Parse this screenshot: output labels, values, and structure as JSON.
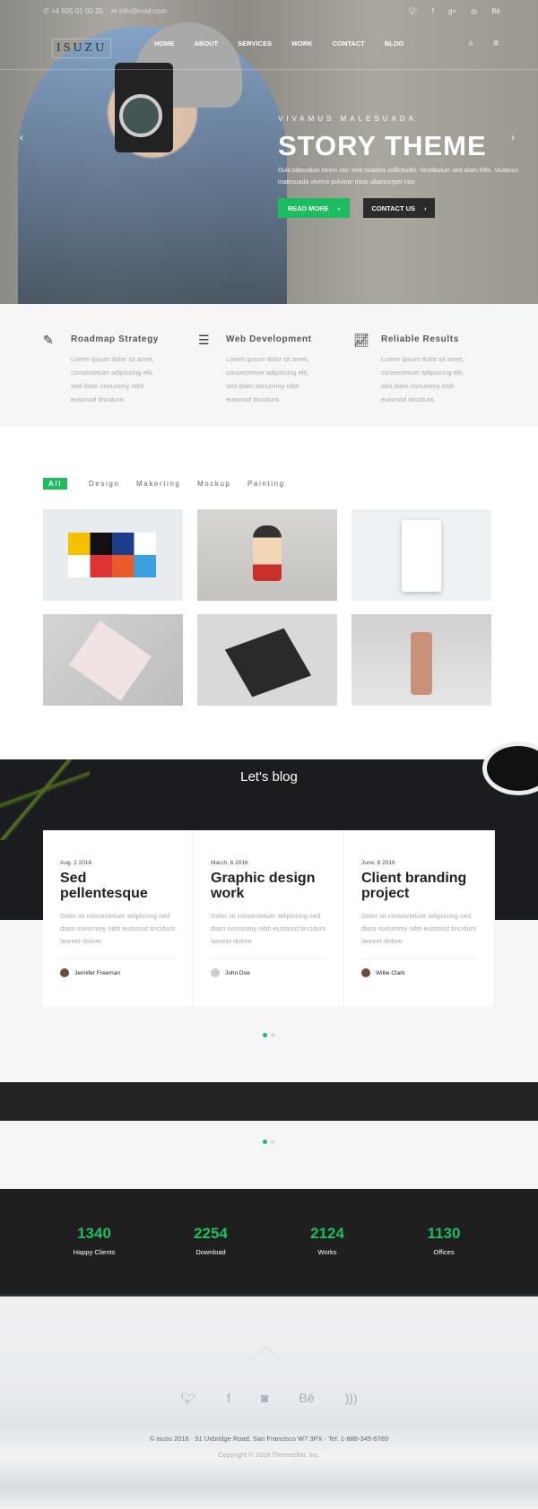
{
  "topbar": {
    "phone": "+4 905 01 00 25",
    "email": "info@mail.com",
    "social": [
      "twitter",
      "facebook",
      "google-plus",
      "instagram",
      "Bē"
    ]
  },
  "nav": {
    "logo": "ISUZU",
    "items": [
      "HOME",
      "ABOUT",
      "SERVICES",
      "WORK",
      "CONTACT",
      "BLOG"
    ]
  },
  "hero": {
    "subtitle": "VIVAMUS MALESUADA",
    "title": "STORY THEME",
    "body": "Duis bibendum lorem non velit sodales sollicitudin. Vestibulum sed diam felis. Vivamus malesuada viverra pulvinar risus ullamcorper non",
    "read_more": "READ MORE",
    "contact": "CONTACT US"
  },
  "features": [
    {
      "icon": "pen-tool-icon",
      "title": "Roadmap Strategy",
      "text": "Lorem ipsum dolor sit amet, consectetuer adipiscing elit, sed diam nonummy nibh euismod tincidunt."
    },
    {
      "icon": "sliders-icon",
      "title": "Web Development",
      "text": "Lorem ipsum dolor sit amet, consectetuer adipiscing elit, sed diam nonummy nibh euismod tincidunt."
    },
    {
      "icon": "chart-icon",
      "title": "Reliable Results",
      "text": "Lorem ipsum dolor sit amet, consectetuer adipiscing elit, sed diam nonummy nibh euismod tincidunt."
    }
  ],
  "filters": [
    "All",
    "Design",
    "Makerting",
    "Mockup",
    "Painting"
  ],
  "blog": {
    "heading": "Let's blog",
    "posts": [
      {
        "date": "Aug. 2 2016",
        "title": "Sed pellentesque",
        "text": "Dolor sit consectetuer adipiscing sed diam nonummy nibh euismod tincidunt laoreet dolore",
        "author": "Jennifer Freeman"
      },
      {
        "date": "March. 6 2016",
        "title": "Graphic design work",
        "text": "Dolor sit consectetuer adipiscing sed diam nonummy nibh euismod tincidunt laoreet dolore",
        "author": "John Doe"
      },
      {
        "date": "June. 8 2016",
        "title": "Client branding project",
        "text": "Dolor sit consectetuer adipiscing sed diam nonummy nibh euismod tincidunt laoreet dolore",
        "author": "Willie Clark"
      }
    ]
  },
  "stats": [
    {
      "n": "1340",
      "l": "Happy Clients"
    },
    {
      "n": "2254",
      "l": "Download"
    },
    {
      "n": "2124",
      "l": "Works"
    },
    {
      "n": "1130",
      "l": "Offices"
    }
  ],
  "footer": {
    "address": "© isuzu 2016  ·  51 Uxbridge Road, San Francisco W7 3PX  ·  Tel: 1-888-345-6789",
    "copyright": "Copyright © 2016 Themesflat. Inc.",
    "social": [
      "twitter",
      "facebook",
      "instagram",
      "Bē",
      "rss"
    ]
  },
  "colors": {
    "accent": "#1bbd60",
    "dark": "#1f1f1f"
  }
}
